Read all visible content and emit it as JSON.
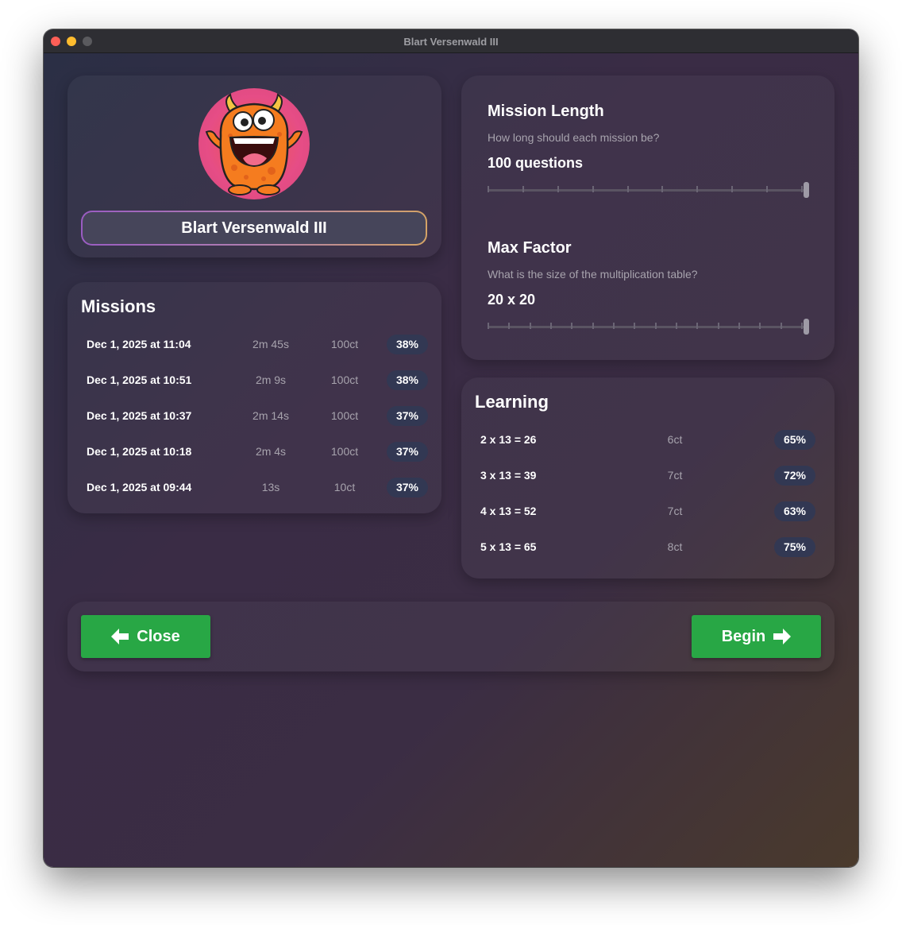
{
  "window": {
    "title": "Blart Versenwald III"
  },
  "profile": {
    "avatar": "orange-monster-avatar",
    "name": "Blart Versenwald III"
  },
  "missions": {
    "title": "Missions",
    "rows": [
      {
        "date": "Dec 1, 2025 at 11:04",
        "duration": "2m 45s",
        "count": "100ct",
        "score": "38%"
      },
      {
        "date": "Dec 1, 2025 at 10:51",
        "duration": "2m 9s",
        "count": "100ct",
        "score": "38%"
      },
      {
        "date": "Dec 1, 2025 at 10:37",
        "duration": "2m 14s",
        "count": "100ct",
        "score": "37%"
      },
      {
        "date": "Dec 1, 2025 at 10:18",
        "duration": "2m 4s",
        "count": "100ct",
        "score": "37%"
      },
      {
        "date": "Dec 1, 2025 at 09:44",
        "duration": "13s",
        "count": "10ct",
        "score": "37%"
      }
    ]
  },
  "settings": {
    "mission_length": {
      "title": "Mission Length",
      "description": "How long should each mission be?",
      "value": "100 questions",
      "slider_level": 1.0
    },
    "max_factor": {
      "title": "Max Factor",
      "description": "What is the size of the multiplication table?",
      "value": "20 x 20",
      "slider_level": 1.0
    }
  },
  "learning": {
    "title": "Learning",
    "rows": [
      {
        "equation": "2 x 13 = 26",
        "count": "6ct",
        "score": "65%"
      },
      {
        "equation": "3 x 13 = 39",
        "count": "7ct",
        "score": "72%"
      },
      {
        "equation": "4 x 13 = 52",
        "count": "7ct",
        "score": "63%"
      },
      {
        "equation": "5 x 13 = 65",
        "count": "8ct",
        "score": "75%"
      }
    ]
  },
  "footer": {
    "close_label": "Close",
    "close_icon": "arrow-left-icon",
    "begin_label": "Begin",
    "begin_icon": "arrow-right-icon"
  },
  "colors": {
    "button_green": "#28a745",
    "badge_bg": "#323853",
    "traffic_red": "#fe5f57",
    "traffic_yellow": "#febc2e"
  }
}
